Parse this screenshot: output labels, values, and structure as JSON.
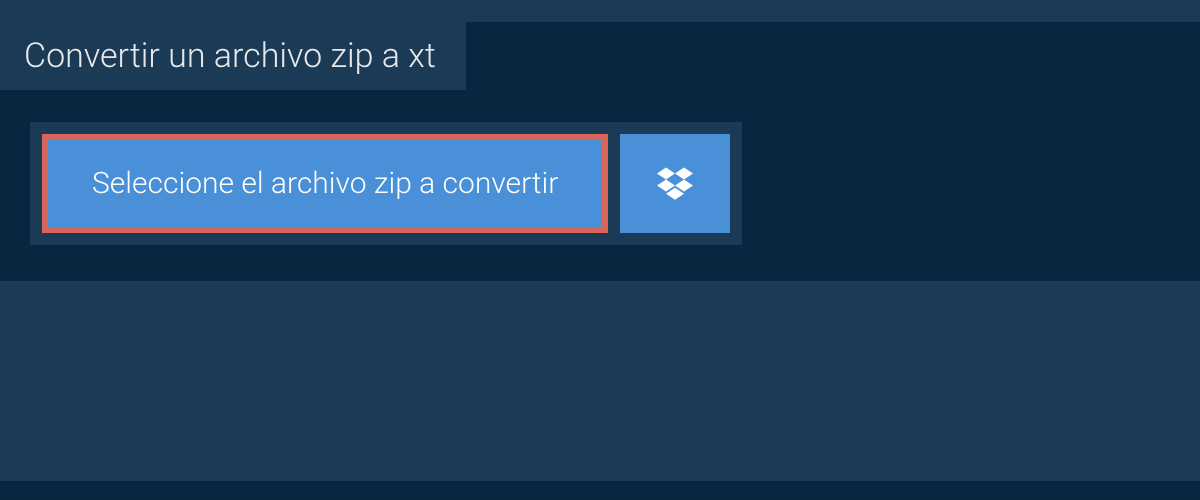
{
  "header": {
    "title": "Convertir un archivo zip a xt"
  },
  "upload": {
    "select_button_label": "Seleccione el archivo zip a convertir"
  },
  "colors": {
    "background": "#0a2540",
    "panel": "#1a3a56",
    "button_primary": "#4a90d9",
    "highlight_border": "#d96459"
  }
}
